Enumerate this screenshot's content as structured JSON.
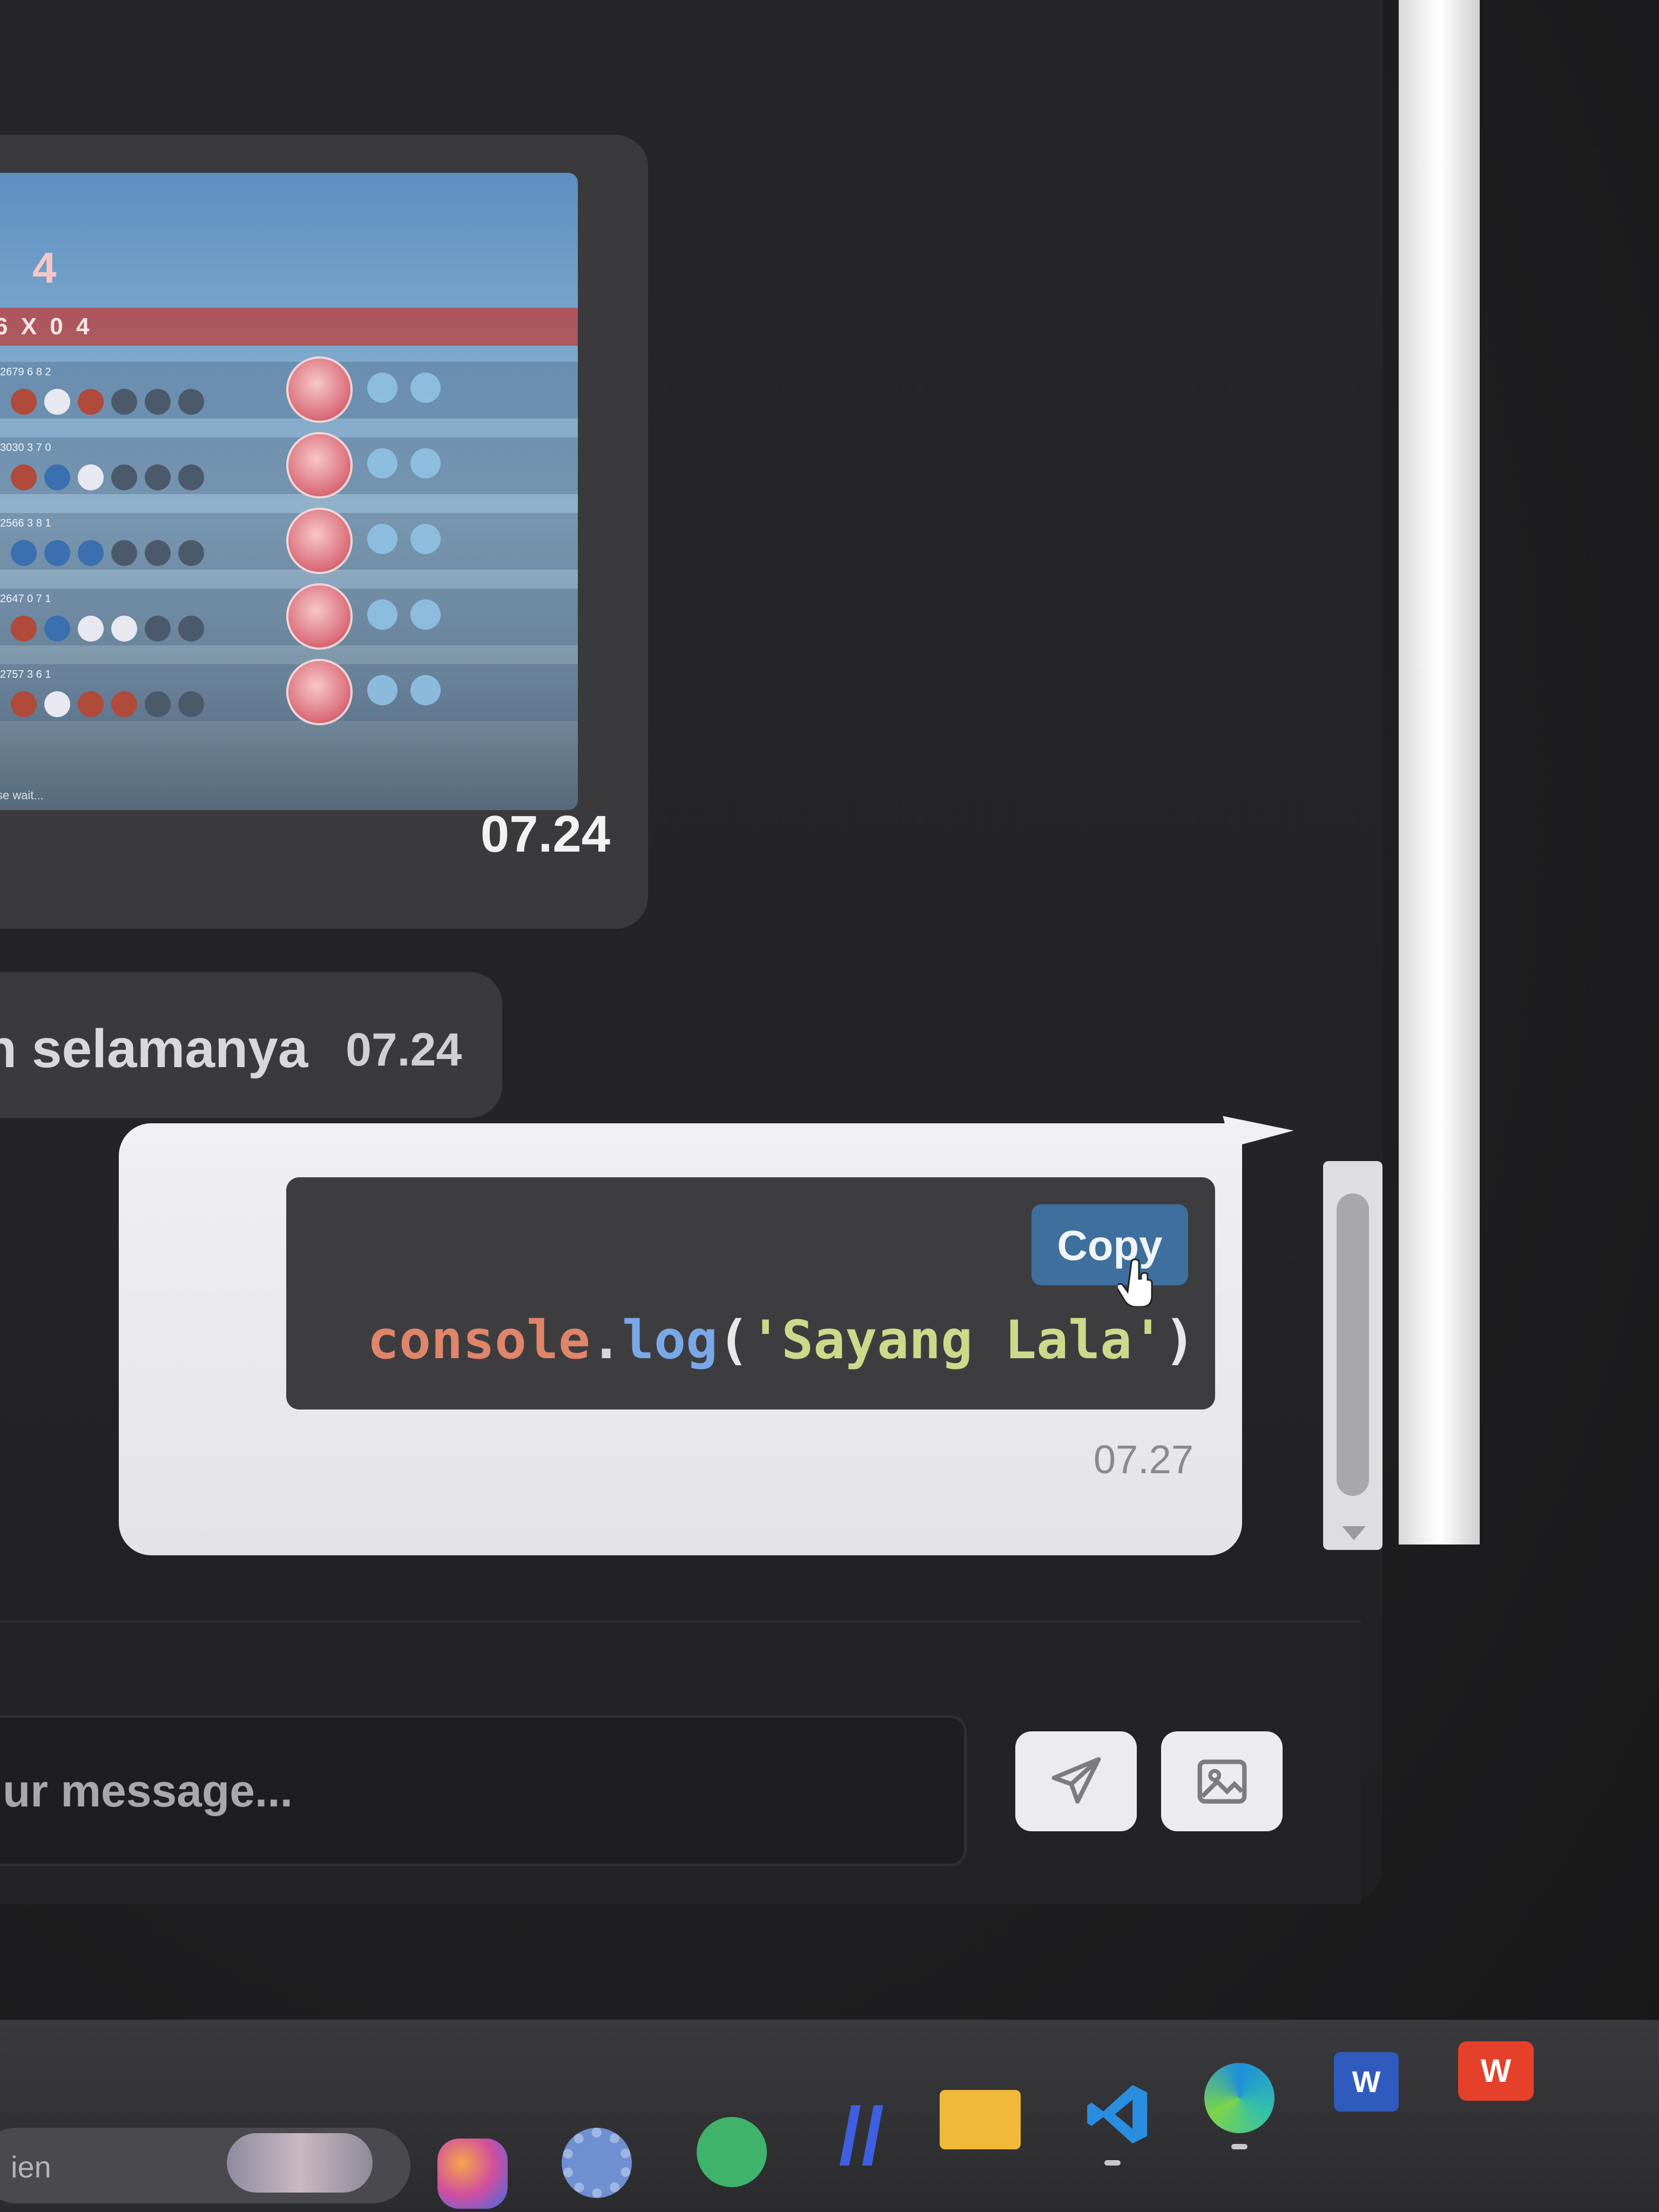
{
  "chat": {
    "image_message": {
      "time": "07.24",
      "game_screenshot": {
        "round_label": "4",
        "banner_text": "6 X 0 4",
        "rows": [
          {
            "stats": "2679 6 8 2"
          },
          {
            "stats": "3030 3 7 0"
          },
          {
            "stats": "2566 3 8 1"
          },
          {
            "stats": "2647 0 7 1"
          },
          {
            "stats": "2757 3 6 1"
          }
        ],
        "footer_text": "Please wait..."
      }
    },
    "text_message": {
      "text": "n selamanya",
      "time": "07.24"
    },
    "code_message": {
      "copy_label": "Copy",
      "code": {
        "object": "console",
        "dot": ".",
        "method": "log",
        "open": "(",
        "string": "'Sayang Lala'",
        "close": ")"
      },
      "time": "07.27"
    }
  },
  "composer": {
    "placeholder": "ur message...",
    "send_icon": "send-icon",
    "image_icon": "image-icon"
  },
  "taskbar": {
    "search_label": "ien",
    "word_label": "W",
    "wps_label": "W",
    "icons": [
      "copilot-icon",
      "settings-icon",
      "whatsapp-icon",
      "slash-app-icon",
      "file-explorer-icon",
      "vscode-icon",
      "edge-icon",
      "word-icon",
      "wps-icon"
    ]
  },
  "colors": {
    "copy_button": "#3f6f9c",
    "code_background": "#3d3d40",
    "received_bubble": "#3a3a3c",
    "sent_bubble": "#f0f0f2"
  }
}
